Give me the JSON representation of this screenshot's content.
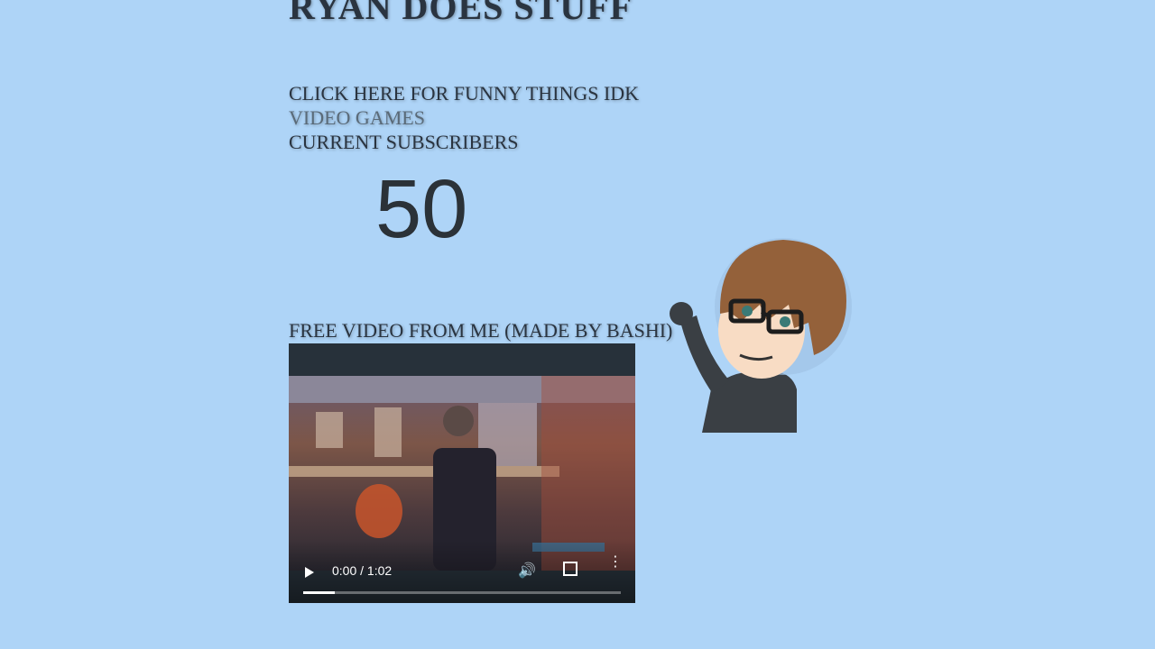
{
  "page": {
    "title": "RYAN DOES STUFF"
  },
  "nav": {
    "funny_link": "CLICK HERE FOR FUNNY THINGS IDK",
    "games_link": "VIDEO GAMES",
    "subscribers_label": "CURRENT SUBSCRIBERS"
  },
  "subscribers": {
    "count": "50"
  },
  "video": {
    "caption": "FREE VIDEO FROM ME (MADE BY BASHI)",
    "time": "0:00 / 1:02",
    "progress": 0.1,
    "play_icon": "play-icon",
    "volume_icon": "volume-icon",
    "fullscreen_icon": "fullscreen-icon",
    "more_icon": "more-vertical-icon"
  },
  "colors": {
    "background": "#aed4f7",
    "text": "#2a3440",
    "player": "#27313a"
  }
}
